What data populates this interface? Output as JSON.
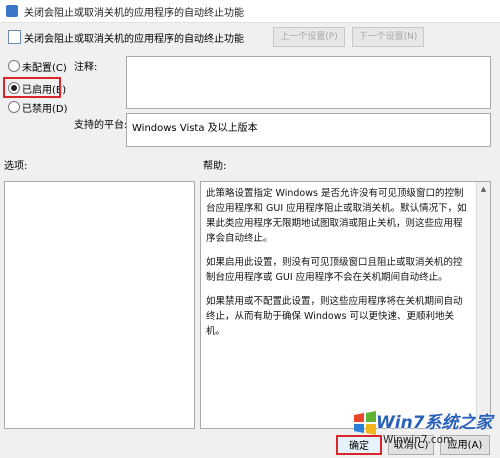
{
  "window": {
    "title": "关闭会阻止或取消关机的应用程序的自动终止功能"
  },
  "header": {
    "policy_title": "关闭会阻止或取消关机的应用程序的自动终止功能",
    "prev_label": "上一个设置(P)",
    "next_label": "下一个设置(N)"
  },
  "state_options": [
    {
      "label": "未配置(C)",
      "checked": false
    },
    {
      "label": "已启用(E)",
      "checked": true
    },
    {
      "label": "已禁用(D)",
      "checked": false
    }
  ],
  "comment": {
    "label": "注释:",
    "value": ""
  },
  "supported": {
    "label": "支持的平台:",
    "value": "Windows Vista 及以上版本"
  },
  "options": {
    "label": "选项:"
  },
  "help": {
    "label": "帮助:",
    "paragraphs": [
      "此策略设置指定 Windows 是否允许没有可见顶级窗口的控制台应用程序和 GUI 应用程序阻止或取消关机。默认情况下，如果此类应用程序无限期地试图取消或阻止关机，则这些应用程序会自动终止。",
      "如果启用此设置，则没有可见顶级窗口且阻止或取消关机的控制台应用程序或 GUI 应用程序不会在关机期间自动终止。",
      "如果禁用或不配置此设置，则这些应用程序将在关机期间自动终止，从而有助于确保 Windows 可以更快速、更顺利地关机。"
    ]
  },
  "footer": {
    "ok_label": "确定",
    "cancel_label": "取消(C)",
    "apply_label": "应用(A)"
  },
  "watermark": {
    "brand": "Win7系统之家",
    "url": "Winwin7.com"
  },
  "colors": {
    "highlight": "#d9262a",
    "watermark_blue": "#2a62b8"
  }
}
